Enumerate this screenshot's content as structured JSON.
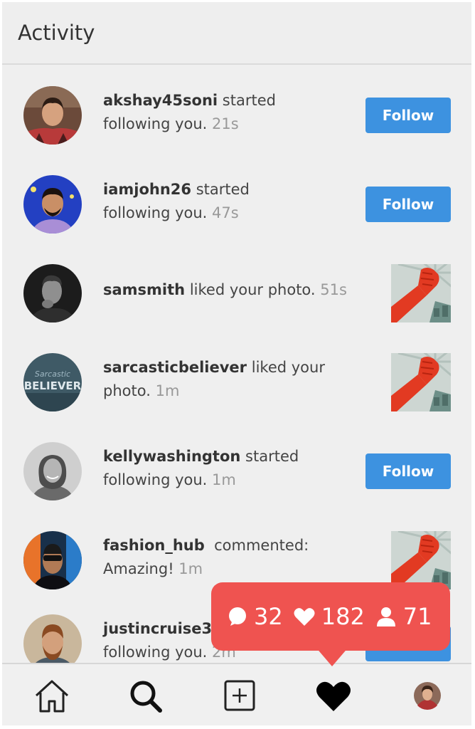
{
  "header": {
    "title": "Activity"
  },
  "feed": [
    {
      "username": "akshay45soni",
      "action": "started",
      "tail": "following you.",
      "time": "21s",
      "right": "follow"
    },
    {
      "username": "iamjohn26",
      "action": "started",
      "tail": "following you.",
      "time": "47s",
      "right": "follow"
    },
    {
      "username": "samsmith",
      "action": "liked your photo.",
      "tail": "",
      "time": "51s",
      "right": "thumbnail"
    },
    {
      "username": "sarcasticbeliever",
      "action": "liked your",
      "tail": "photo.",
      "time": "1m",
      "right": "thumbnail",
      "avatar_text_top": "Sarcastic",
      "avatar_text_bottom": "BELIEVER"
    },
    {
      "username": "kellywashington",
      "action": "started",
      "tail": "following you.",
      "time": "1m",
      "right": "follow"
    },
    {
      "username": "fashion_hub",
      "action": "commented:",
      "tail": "Amazing!",
      "time": "1m",
      "right": "thumbnail"
    },
    {
      "username": "justincruise37",
      "action": "",
      "tail": "following you.",
      "time": "2m",
      "right": "follow"
    }
  ],
  "follow_label": "Follow",
  "notification_popup": {
    "comments": "32",
    "likes": "182",
    "followers": "71"
  },
  "navbar": {
    "items": [
      "home-icon",
      "search-icon",
      "add-post-icon",
      "heart-icon",
      "profile-avatar"
    ]
  },
  "colors": {
    "follow_button": "#3d92e0",
    "popup": "#ef5350",
    "background": "#efefef"
  }
}
